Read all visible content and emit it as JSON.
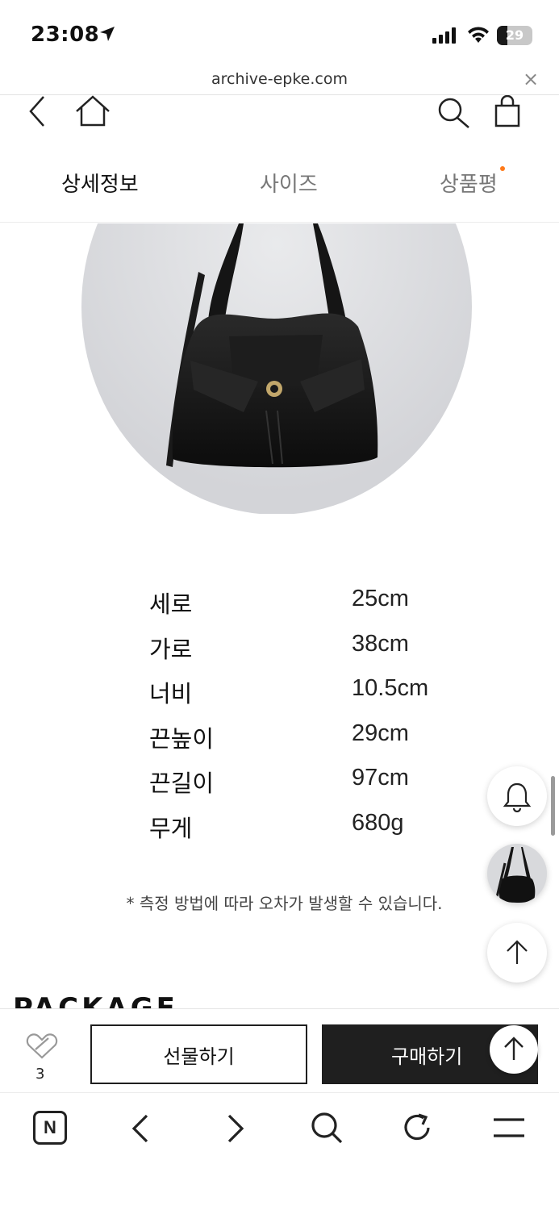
{
  "status_bar": {
    "time": "23:08",
    "battery": "29",
    "battery_level": 0.29,
    "icons": [
      "location-arrow-icon",
      "cellular-signal-icon",
      "wifi-icon",
      "battery-icon"
    ]
  },
  "browser": {
    "url": "archive-epke.com",
    "close_icon": "×"
  },
  "site_header": {
    "icons": [
      "back-chevron-icon",
      "home-icon",
      "search-icon",
      "shopping-bag-icon"
    ]
  },
  "tabs": [
    {
      "label": "상세정보",
      "active": true
    },
    {
      "label": "사이즈",
      "active": false
    },
    {
      "label": "상품평",
      "active": false,
      "has_new_dot": true
    }
  ],
  "product_image": {
    "alt_icon": "black-leather-shoulder-bag-photo"
  },
  "sizes": [
    {
      "label": "세로",
      "value": "25cm"
    },
    {
      "label": "가로",
      "value": "38cm"
    },
    {
      "label": "너비",
      "value": "10.5cm"
    },
    {
      "label": "끈높이",
      "value": "29cm"
    },
    {
      "label": "끈길이",
      "value": "97cm"
    },
    {
      "label": "무게",
      "value": "680g"
    }
  ],
  "note": "* 측정 방법에 따라 오차가 발생할 수 있습니다.",
  "package_heading": "PACKAGE",
  "floating": {
    "icons": [
      "bell-icon",
      "product-thumbnail",
      "arrow-up-icon"
    ]
  },
  "buy_bar": {
    "like_count": "3",
    "gift_label": "선물하기",
    "buy_label": "구매하기"
  },
  "toolbar": {
    "n_label": "N",
    "icons": [
      "naver-n-icon",
      "back-icon",
      "forward-icon",
      "search-icon",
      "reload-icon",
      "menu-icon"
    ]
  },
  "colors": {
    "accent_dot": "#ff7a1a",
    "buy_button": "#1f1f1f",
    "photo_bg": "#dcdde0"
  }
}
